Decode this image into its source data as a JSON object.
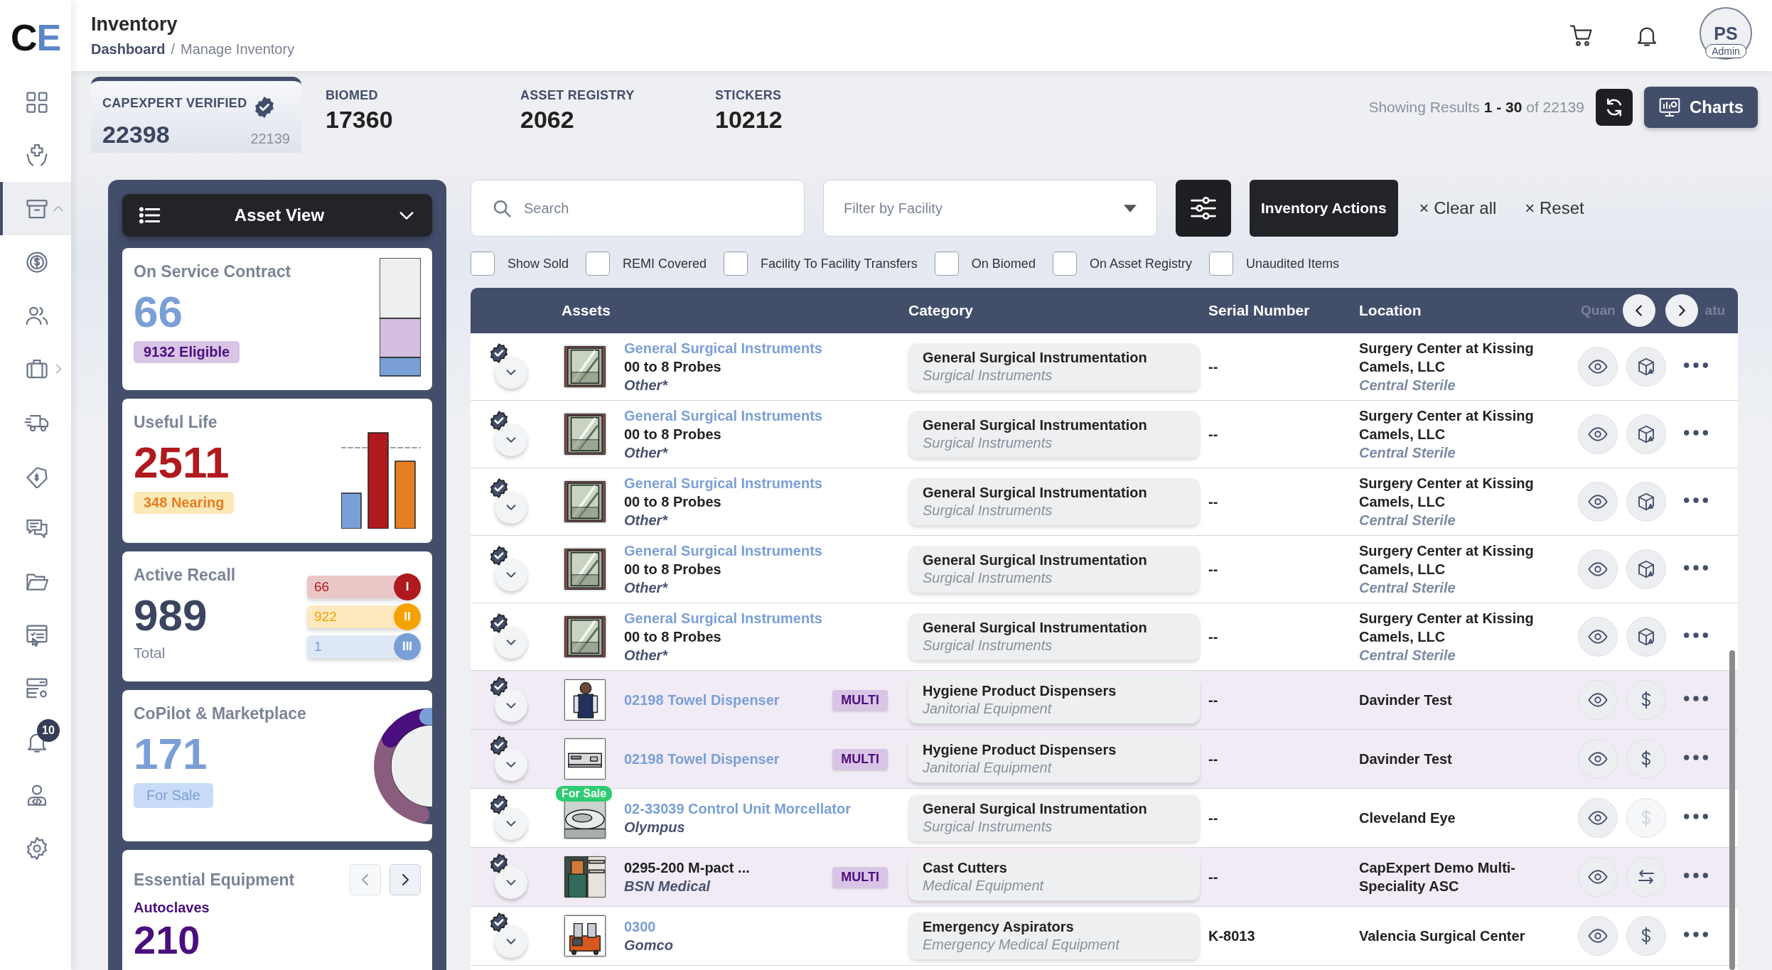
{
  "logo": [
    "C",
    "E"
  ],
  "sidebar": {
    "items": [
      {
        "selected": false
      },
      {
        "selected": false
      },
      {
        "selected": true,
        "expanded": true
      },
      {
        "selected": false
      },
      {
        "selected": false
      },
      {
        "selected": false,
        "expanded": false
      },
      {
        "selected": false
      },
      {
        "selected": false
      },
      {
        "selected": false
      },
      {
        "selected": false
      },
      {
        "selected": false
      },
      {
        "selected": false
      },
      {
        "selected": false,
        "badge": "10"
      },
      {
        "selected": false
      },
      {
        "selected": false
      }
    ]
  },
  "header": {
    "title": "Inventory",
    "breadcrumb": [
      {
        "label": "Dashboard",
        "link": true
      },
      {
        "label": "Manage Inventory",
        "link": false
      }
    ],
    "separator": "/",
    "user": {
      "initials": "PS",
      "role": "Admin"
    }
  },
  "stats": [
    {
      "label": "CAPEXPERT VERIFIED",
      "value": "22398",
      "sub_value": "22139",
      "verified": true,
      "selected": true
    },
    {
      "label": "BIOMED",
      "value": "17360",
      "verified": false,
      "selected": false
    },
    {
      "label": "ASSET REGISTRY",
      "value": "2062",
      "verified": false,
      "selected": false
    },
    {
      "label": "STICKERS",
      "value": "10212",
      "verified": false,
      "selected": false
    }
  ],
  "results": "Showing Results **1 - 30** of 22139",
  "charts_button": "Charts",
  "asset_view": "Asset View",
  "cards": {
    "service": {
      "title": "On Service Contract",
      "value": "66",
      "badge": "9132 Eligible"
    },
    "useful_life": {
      "title": "Useful Life",
      "value": "2511",
      "badge": "348 Nearing"
    },
    "recall": {
      "title": "Active Recall",
      "value": "989",
      "caption": "Total",
      "classes": [
        {
          "value": "66",
          "label": "I",
          "color": "#b0191e"
        },
        {
          "value": "922",
          "label": "II",
          "color": "#f5a200"
        },
        {
          "value": "1",
          "label": "III",
          "color": "#7a9fd6"
        }
      ]
    },
    "copilot": {
      "title": "CoPilot & Marketplace",
      "value": "171",
      "badge": "For Sale"
    },
    "essential": {
      "title": "Essential Equipment",
      "subtitle": "Autoclaves",
      "value": "210"
    }
  },
  "search": {
    "placeholder": "Search"
  },
  "facility_filter": {
    "placeholder": "Filter by Facility"
  },
  "actions_button": "Inventory Actions",
  "clear_all": "× Clear all",
  "reset": "× Reset",
  "filters": [
    {
      "label": "Show Sold",
      "checked": false
    },
    {
      "label": "REMI Covered",
      "checked": false
    },
    {
      "label": "Facility To Facility Transfers",
      "checked": false
    },
    {
      "label": "On Biomed",
      "checked": false
    },
    {
      "label": "On Asset Registry",
      "checked": false
    },
    {
      "label": "Unaudited Items",
      "checked": false
    }
  ],
  "table": {
    "columns": [
      "Assets",
      "Category",
      "Serial Number",
      "Location",
      "Quan",
      "atu"
    ],
    "rows": [
      {
        "verified": true,
        "highlighted": false,
        "name": "General Surgical Instruments",
        "name_link": true,
        "model": "00 to 8 Probes",
        "manufacturer": "Other*",
        "category": "General Surgical Instrumentation",
        "subcategory": "Surgical Instruments",
        "serial": "--",
        "location": "Surgery Center at Kissing Camels, LLC",
        "department": "Central Sterile",
        "action": {
          "kind": "box",
          "disabled": false
        }
      },
      {
        "verified": true,
        "highlighted": false,
        "name": "General Surgical Instruments",
        "name_link": true,
        "model": "00 to 8 Probes",
        "manufacturer": "Other*",
        "category": "General Surgical Instrumentation",
        "subcategory": "Surgical Instruments",
        "serial": "--",
        "location": "Surgery Center at Kissing Camels, LLC",
        "department": "Central Sterile",
        "action": {
          "kind": "box",
          "disabled": false
        }
      },
      {
        "verified": true,
        "highlighted": false,
        "name": "General Surgical Instruments",
        "name_link": true,
        "model": "00 to 8 Probes",
        "manufacturer": "Other*",
        "category": "General Surgical Instrumentation",
        "subcategory": "Surgical Instruments",
        "serial": "--",
        "location": "Surgery Center at Kissing Camels, LLC",
        "department": "Central Sterile",
        "action": {
          "kind": "box",
          "disabled": false
        }
      },
      {
        "verified": true,
        "highlighted": false,
        "name": "General Surgical Instruments",
        "name_link": true,
        "model": "00 to 8 Probes",
        "manufacturer": "Other*",
        "category": "General Surgical Instrumentation",
        "subcategory": "Surgical Instruments",
        "serial": "--",
        "location": "Surgery Center at Kissing Camels, LLC",
        "department": "Central Sterile",
        "action": {
          "kind": "box",
          "disabled": false
        }
      },
      {
        "verified": true,
        "highlighted": false,
        "name": "General Surgical Instruments",
        "name_link": true,
        "model": "00 to 8 Probes",
        "manufacturer": "Other*",
        "category": "General Surgical Instrumentation",
        "subcategory": "Surgical Instruments",
        "serial": "--",
        "location": "Surgery Center at Kissing Camels, LLC",
        "department": "Central Sterile",
        "action": {
          "kind": "box",
          "disabled": false
        }
      },
      {
        "verified": true,
        "highlighted": true,
        "name": "02198 Towel Dispenser",
        "name_link": true,
        "tag": "MULTI",
        "category": "Hygiene Product Dispensers",
        "subcategory": "Janitorial Equipment",
        "serial": "--",
        "location": "Davinder Test",
        "action": {
          "kind": "dollar",
          "disabled": false
        }
      },
      {
        "verified": true,
        "highlighted": true,
        "name": "02198 Towel Dispenser",
        "name_link": true,
        "tag": "MULTI",
        "category": "Hygiene Product Dispensers",
        "subcategory": "Janitorial Equipment",
        "serial": "--",
        "location": "Davinder Test",
        "action": {
          "kind": "dollar",
          "disabled": false
        }
      },
      {
        "verified": true,
        "highlighted": false,
        "name": "02-33039 Control Unit Morcellator",
        "name_link": true,
        "manufacturer": "Olympus",
        "sale_tag": "For Sale",
        "category": "General Surgical Instrumentation",
        "subcategory": "Surgical Instruments",
        "serial": "--",
        "location": "Cleveland Eye",
        "action": {
          "kind": "dollar",
          "disabled": true
        }
      },
      {
        "verified": true,
        "highlighted": true,
        "name": "0295-200 M-pact ...",
        "name_link": false,
        "manufacturer": "BSN Medical",
        "tag": "MULTI",
        "category": "Cast Cutters",
        "subcategory": "Medical Equipment",
        "serial": "--",
        "location": "CapExpert Demo Multi-Speciality ASC",
        "action": {
          "kind": "transfer",
          "disabled": false
        }
      },
      {
        "verified": true,
        "highlighted": false,
        "name": "0300",
        "name_link": true,
        "manufacturer": "Gomco",
        "category": "Emergency Aspirators",
        "subcategory": "Emergency Medical Equipment",
        "serial": "K-8013",
        "location": "Valencia Surgical Center",
        "action": {
          "kind": "dollar",
          "disabled": false
        }
      }
    ]
  }
}
